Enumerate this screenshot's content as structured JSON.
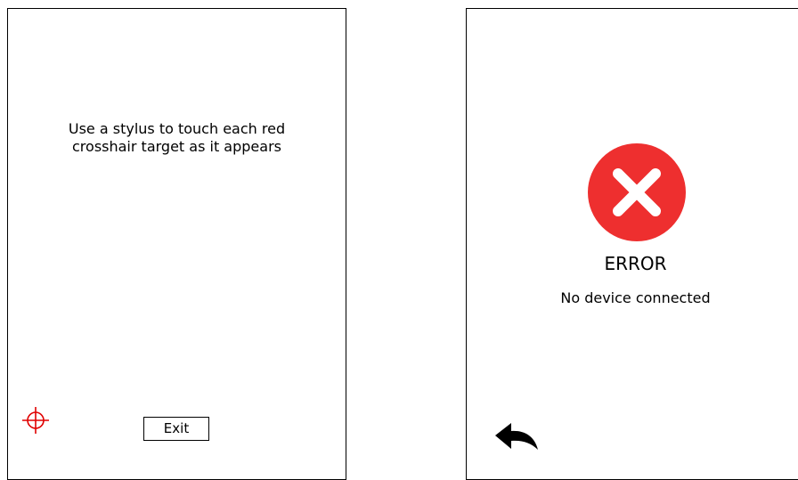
{
  "calibration_screen": {
    "instruction_line1": "Use a stylus to touch each red",
    "instruction_line2": "crosshair target as it appears",
    "target_icon": "crosshair-target-icon",
    "target_color": "#e00000",
    "exit_label": "Exit"
  },
  "error_screen": {
    "icon": "error-x-icon",
    "icon_color": "#ee2f2f",
    "title": "ERROR",
    "message": "No device connected",
    "back_icon": "back-arrow-icon"
  }
}
